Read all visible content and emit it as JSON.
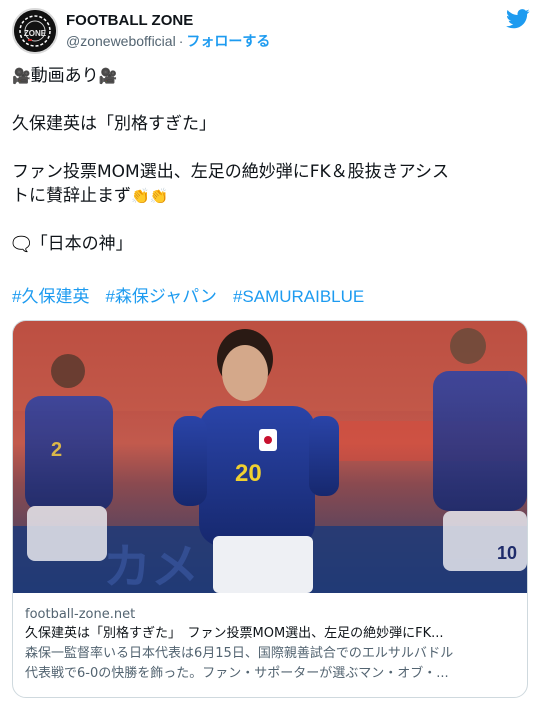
{
  "account": {
    "display_name": "FOOTBALL ZONE",
    "handle": "@zonewebofficial",
    "separator": "·",
    "follow_label": "フォローする",
    "avatar_text": "ZONE"
  },
  "tweet": {
    "line1_emoji_left": "🎥",
    "line1_text": "動画あり",
    "line1_emoji_right": "🎥",
    "line2": "久保建英は「別格すぎた」",
    "line3": "ファン投票MOM選出、左足の絶妙弾にFK＆股抜きアシス",
    "line4_text": "トに賛辞止まず",
    "line4_emoji": "👏👏",
    "line5_emoji": "🗨️",
    "line5_text": "「日本の神」"
  },
  "hashtags": [
    "#久保建英",
    "#森保ジャパン",
    "#SAMURAIBLUE"
  ],
  "card": {
    "domain": "football-zone.net",
    "title": "久保建英は「別格すぎた」　ファン投票MOM選出、左足の絶妙弾にFK...",
    "desc_line1": "森保一監督率いる日本代表は6月15日、国際親善試合でのエルサルバドル",
    "desc_line2": "代表戦で6-0の快勝を飾った。ファン・サポーターが選ぶマン・オブ・...",
    "jersey_number_center": "20",
    "jersey_number_left": "2",
    "jersey_number_right": "10"
  },
  "colors": {
    "link": "#1d9bf0",
    "text": "#0f1419",
    "secondary": "#536471",
    "border": "#cfd9de",
    "twitter_blue": "#1d9bf0"
  },
  "icons": {
    "brand": "twitter-bird-icon"
  }
}
